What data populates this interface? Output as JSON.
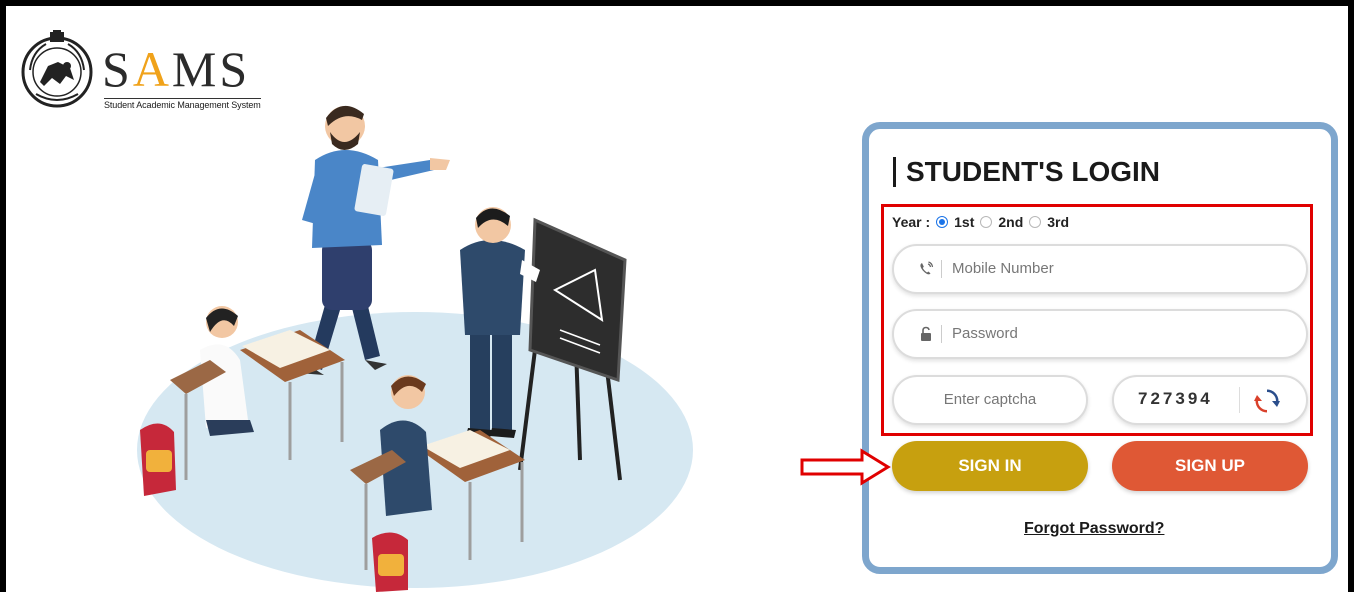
{
  "branding": {
    "logo_letters": [
      "S",
      "A",
      "MS"
    ],
    "subtitle": "Student Academic Management System",
    "accent_color": "#f0a21a"
  },
  "login": {
    "title": "STUDENT'S LOGIN",
    "year_label": "Year :",
    "year_options": [
      "1st",
      "2nd",
      "3rd"
    ],
    "year_selected": "1st",
    "mobile_placeholder": "Mobile Number",
    "password_placeholder": "Password",
    "captcha_placeholder": "Enter captcha",
    "captcha_code": "727394",
    "sign_in_label": "SIGN IN",
    "sign_up_label": "SIGN UP",
    "forgot_label": "Forgot Password?"
  },
  "icons": {
    "mobile": "phone-icon",
    "password": "lock-icon",
    "refresh": "refresh-icon",
    "emblem": "odisha-emblem-icon",
    "arrow": "right-arrow-icon"
  },
  "colors": {
    "card_border": "#7ea6cd",
    "highlight_border": "#e00000",
    "sign_in": "#c7a00f",
    "sign_up": "#df5835",
    "radio_selected": "#1a73e8"
  }
}
